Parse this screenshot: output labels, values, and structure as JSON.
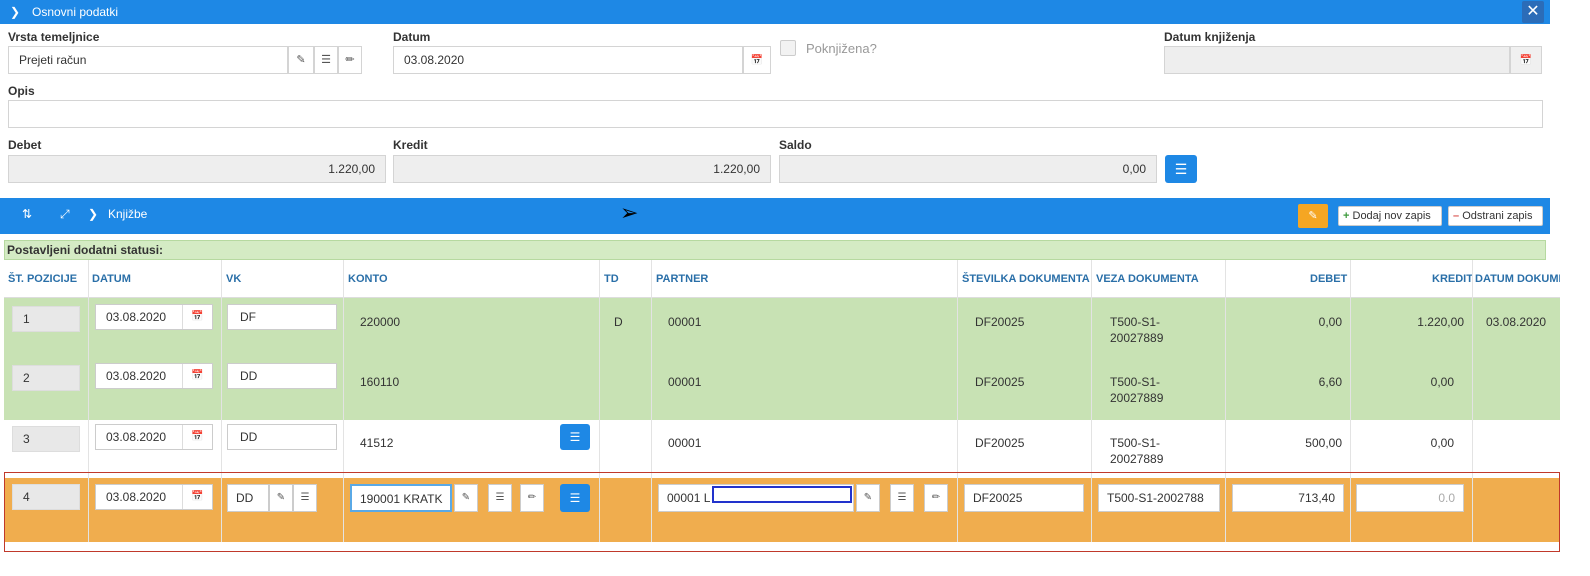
{
  "section1": {
    "title": "Osnovni podatki"
  },
  "form": {
    "vrsta_label": "Vrsta temeljnice",
    "vrsta_value": "Prejeti račun",
    "datum_label": "Datum",
    "datum_value": "03.08.2020",
    "poknjizena_label": "Poknjižena?",
    "datum_knjizenja_label": "Datum knjiženja",
    "opis_label": "Opis",
    "debet_label": "Debet",
    "debet_value": "1.220,00",
    "kredit_label": "Kredit",
    "kredit_value": "1.220,00",
    "saldo_label": "Saldo",
    "saldo_value": "0,00"
  },
  "section2": {
    "title": "Knjižbe",
    "dodaj_label": "Dodaj nov zapis",
    "odstrani_label": "Odstrani zapis",
    "status_text": "Postavljeni dodatni statusi:"
  },
  "table": {
    "headers": [
      "ŠT. POZICIJE",
      "DATUM",
      "VK",
      "KONTO",
      "TD",
      "PARTNER",
      "ŠTEVILKA DOKUMENTA",
      "VEZA DOKUMENTA",
      "DEBET",
      "KREDIT",
      "DATUM DOKUMENTA"
    ],
    "rows": [
      {
        "pos": "1",
        "datum": "03.08.2020",
        "vk": "DF",
        "konto": "220000",
        "td": "D",
        "partner": "00001",
        "st_dok": "DF20025",
        "veza1": "T500-S1-",
        "veza2": "20027889",
        "debet": "0,00",
        "kredit": "1.220,00",
        "datum_dok": "03.08.2020"
      },
      {
        "pos": "2",
        "datum": "03.08.2020",
        "vk": "DD",
        "konto": "160110",
        "td": "",
        "partner": "00001",
        "st_dok": "DF20025",
        "veza1": "T500-S1-",
        "veza2": "20027889",
        "debet": "6,60",
        "kredit": "0,00",
        "datum_dok": ""
      },
      {
        "pos": "3",
        "datum": "03.08.2020",
        "vk": "DD",
        "konto": "41512",
        "td": "",
        "partner": "00001",
        "st_dok": "DF20025",
        "veza1": "T500-S1-",
        "veza2": "20027889",
        "debet": "500,00",
        "kredit": "0,00",
        "datum_dok": ""
      }
    ],
    "edit_row": {
      "pos": "4",
      "datum": "03.08.2020",
      "vk": "DD",
      "konto": "190001 KRATK",
      "partner": "00001 L",
      "st_dok": "DF20025",
      "veza": "T500-S1-2002788",
      "debet": "713,40",
      "kredit_placeholder": "0.0"
    }
  },
  "colors": {
    "blue": "#1e88e5",
    "green_row": "#c8e2b4",
    "orange_row": "#f0ad4e",
    "edit_btn": "#f5a623"
  }
}
